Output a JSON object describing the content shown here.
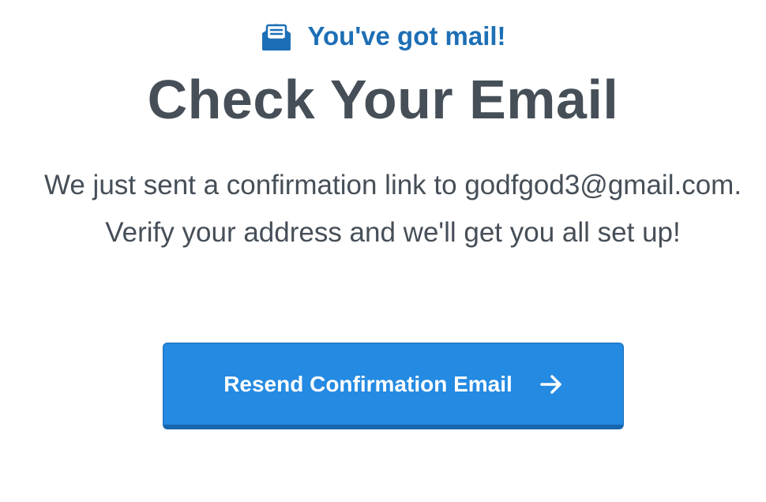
{
  "header": {
    "eyebrow_icon": "open-envelope-icon",
    "eyebrow_text": "You've got mail!",
    "title": "Check Your Email"
  },
  "message": {
    "text": "We just sent a confirmation link to godfgod3@gmail.com. Verify your address and we'll get you all set up!"
  },
  "resend_button": {
    "label": "Resend Confirmation Email",
    "icon": "arrow-right-icon"
  },
  "colors": {
    "accent": "#1d6fb5",
    "button_bg": "#248ae2",
    "text": "#464f58"
  }
}
